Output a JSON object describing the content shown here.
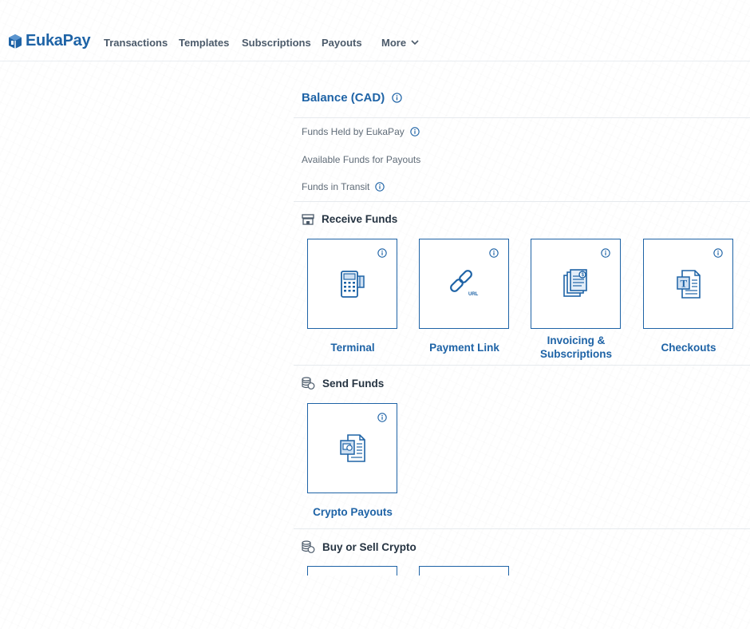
{
  "brand": {
    "name": "EukaPay",
    "color": "#1e63a6"
  },
  "nav": {
    "items": [
      "Transactions",
      "Templates",
      "Subscriptions",
      "Payouts"
    ],
    "more_label": "More"
  },
  "balance": {
    "title": "Balance (CAD)",
    "rows": [
      "Funds Held by EukaPay",
      "Available Funds for Payouts",
      "Funds in Transit"
    ]
  },
  "sections": {
    "receive": {
      "title": "Receive Funds",
      "cards": [
        {
          "label": "Terminal",
          "icon": "card-terminal-icon"
        },
        {
          "label": "Payment Link",
          "icon": "url-link-icon"
        },
        {
          "label": "Invoicing & Subscriptions",
          "icon": "invoice-documents-icon"
        },
        {
          "label": "Checkouts",
          "icon": "template-document-icon"
        }
      ]
    },
    "send": {
      "title": "Send Funds",
      "cards": [
        {
          "label": "Crypto Payouts",
          "icon": "crypto-payout-icon"
        }
      ]
    },
    "buy_sell": {
      "title": "Buy or Sell Crypto"
    }
  }
}
